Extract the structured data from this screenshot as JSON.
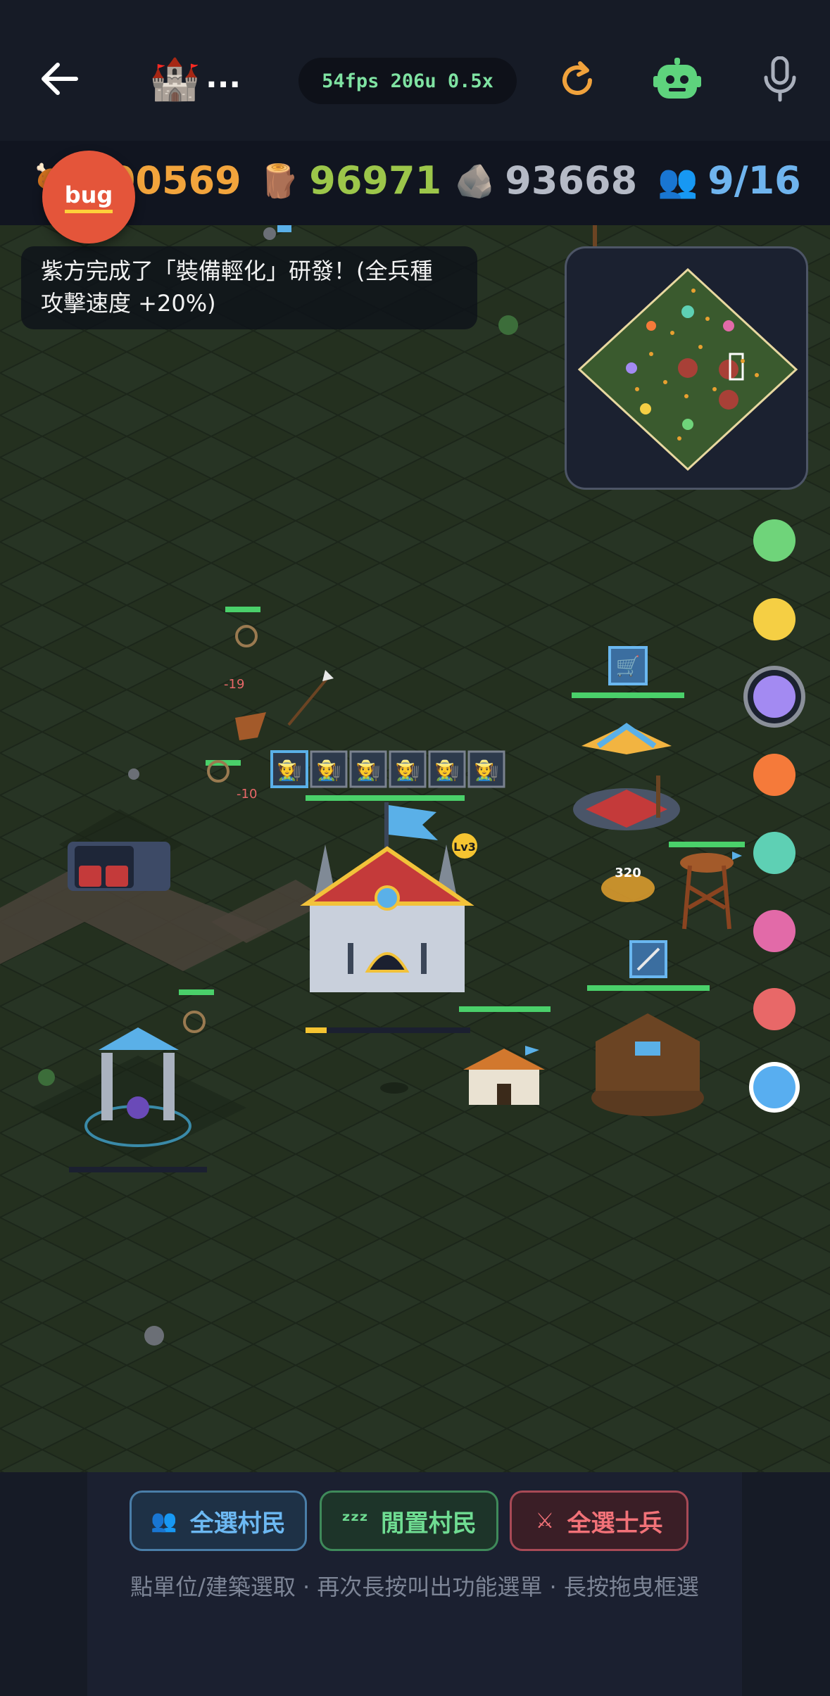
{
  "header": {
    "back_icon": "arrow-left-icon",
    "game_icon": "🏰",
    "title": "...",
    "stats": "54fps 206u 0.5x",
    "refresh_icon": "refresh-icon",
    "robot_icon": "robot-icon",
    "mic_icon": "microphone-icon"
  },
  "resources": {
    "food": {
      "icon": "🍖",
      "value": "100569"
    },
    "wood": {
      "icon": "🪵",
      "value": "96971"
    },
    "stone": {
      "icon": "🪨",
      "value": "93668"
    },
    "population": {
      "icon": "👥",
      "value": "9/16"
    }
  },
  "bug_button": {
    "label": "bug"
  },
  "notification": {
    "line1": "紫方完成了「裝備輕化」研發！(全兵種",
    "line2": "攻擊速度 +20%)"
  },
  "map": {
    "damage_texts": [
      "-19",
      "-10"
    ],
    "town_center_level": "Lv3",
    "farm_count": "320",
    "villager_queue_icon": "villager-icon",
    "villager_queue_count": 6
  },
  "player_colors": [
    "#6fd47a",
    "#f5cf44",
    "#a38af2",
    "#f57a3a",
    "#5ed0b4",
    "#e26aa8",
    "#e86868",
    "#58aef0"
  ],
  "selected_color_index": 2,
  "active_color_index": 7,
  "bottom": {
    "select_villagers": {
      "icon": "👥",
      "label": "全選村民"
    },
    "idle_villagers": {
      "icon": "ᶻᶻᶻ",
      "label": "閒置村民"
    },
    "select_soldiers": {
      "icon": "⚔",
      "label": "全選士兵"
    },
    "hint": "點單位/建築選取 · 再次長按叫出功能選單 · 長按拖曳框選"
  }
}
